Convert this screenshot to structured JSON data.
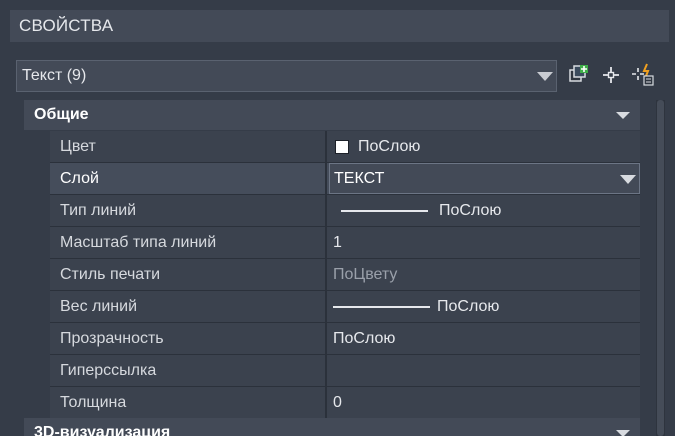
{
  "palette": {
    "title": "СВОЙСТВА"
  },
  "selection": {
    "label": "Текст (9)"
  },
  "toolbar": {
    "quick_select": "quick-select-icon",
    "select_objects": "select-objects-icon",
    "toggle_pickadd": "toggle-pickadd-icon"
  },
  "categories": {
    "general": {
      "label": "Общие",
      "rows": [
        {
          "name": "Цвет",
          "value": "ПоСлою"
        },
        {
          "name": "Слой",
          "value": "ТЕКСТ"
        },
        {
          "name": "Тип линий",
          "value": "ПоСлою"
        },
        {
          "name": "Масштаб типа линий",
          "value": "1"
        },
        {
          "name": "Стиль печати",
          "value": "ПоЦвету"
        },
        {
          "name": "Вес линий",
          "value": "ПоСлою"
        },
        {
          "name": "Прозрачность",
          "value": "ПоСлою"
        },
        {
          "name": "Гиперссылка",
          "value": ""
        },
        {
          "name": "Толщина",
          "value": "0"
        }
      ]
    },
    "viz3d": {
      "label": "3D-визуализация"
    }
  },
  "colors": {
    "color_swatch": "#ffffff",
    "accent_bg": "#353c48"
  }
}
